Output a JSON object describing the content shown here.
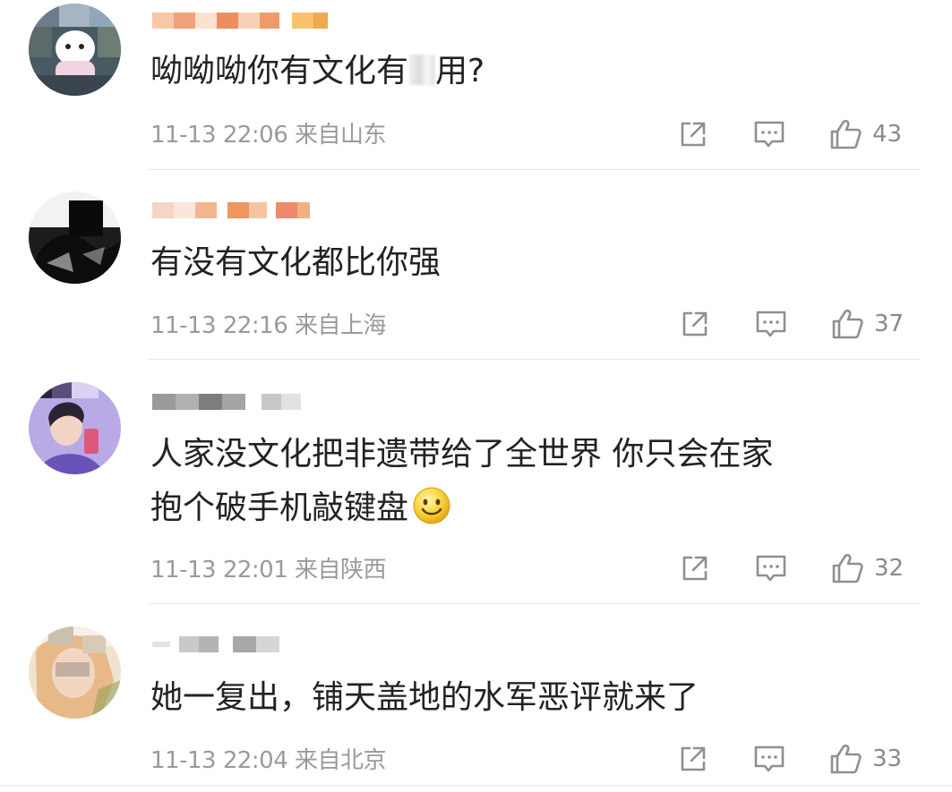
{
  "comments": [
    {
      "text_prefix": "呦呦呦你有文化有",
      "text_suffix": "用?",
      "date": "11-13 22:06",
      "location": "来自山东",
      "likes": "43"
    },
    {
      "text": "有没有文化都比你强",
      "date": "11-13 22:16",
      "location": "来自上海",
      "likes": "37"
    },
    {
      "text_line1": "人家没文化把非遗带给了全世界 你只会在家",
      "text_line2": "抱个破手机敲键盘",
      "date": "11-13 22:01",
      "location": "来自陕西",
      "likes": "32"
    },
    {
      "text": "她一复出，铺天盖地的水军恶评就来了",
      "date": "11-13 22:04",
      "location": "来自北京",
      "likes": "33"
    }
  ],
  "icons": {
    "share": "share-icon",
    "comment": "comment-icon",
    "like": "thumbs-up-icon",
    "smiley": "smiley-emoji-icon"
  },
  "colors": {
    "meta_text": "#9a9a9a",
    "icon_stroke": "#8f8f8f",
    "divider": "#e8e8e8"
  }
}
